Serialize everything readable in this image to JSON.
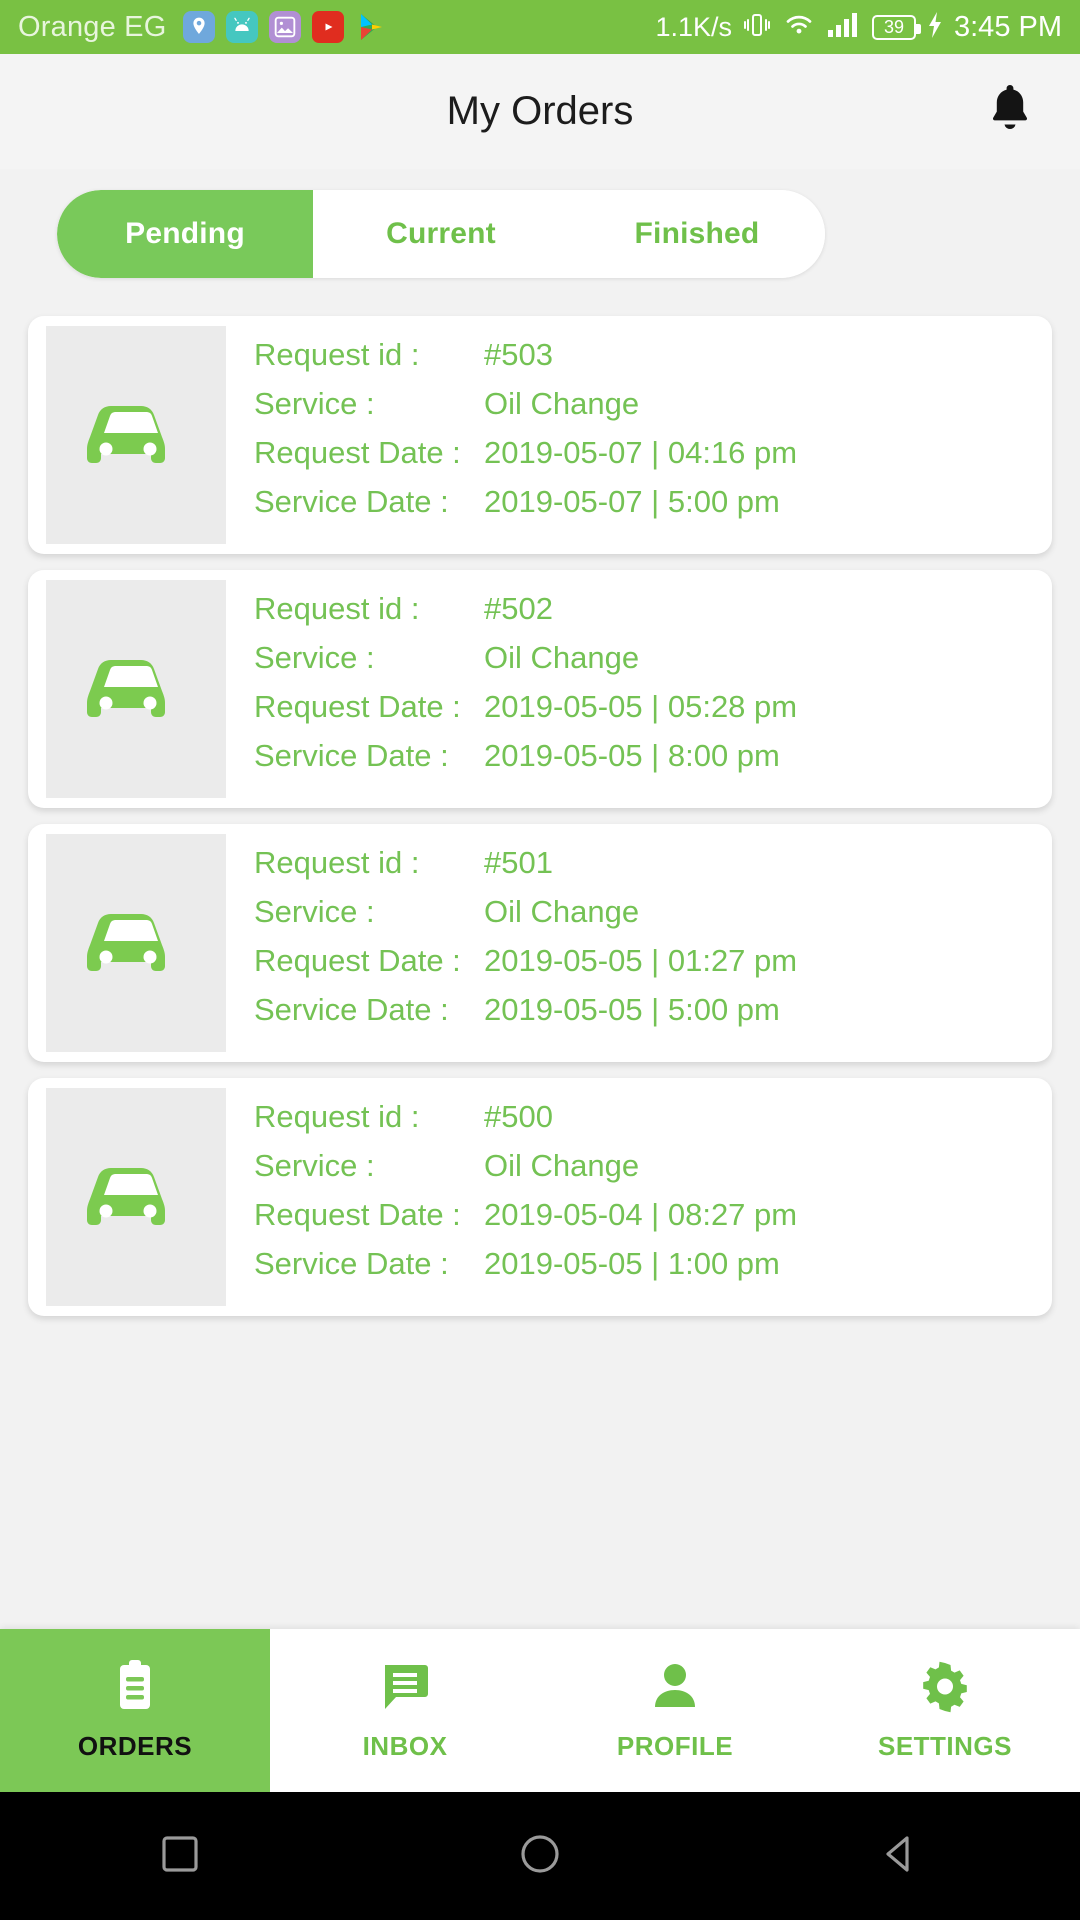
{
  "status_bar": {
    "carrier": "Orange EG",
    "network_speed": "1.1K/s",
    "battery_level": "39",
    "clock": "3:45 PM",
    "icons": [
      "maps-icon",
      "android-icon",
      "photos-icon",
      "youtube-icon",
      "play-store-icon",
      "vibrate-icon",
      "wifi-icon",
      "signal-icon",
      "battery-icon",
      "charging-bolt-icon"
    ],
    "background_color": "#79c143"
  },
  "header": {
    "title": "My Orders",
    "notification_icon": "bell-icon"
  },
  "tabs": {
    "active_index": 0,
    "items": [
      {
        "label": "Pending"
      },
      {
        "label": "Current"
      },
      {
        "label": "Finished"
      }
    ]
  },
  "labels": {
    "request_id": "Request id :",
    "service": "Service :",
    "request_date": "Request Date :",
    "service_date": "Service Date :"
  },
  "orders": [
    {
      "request_id": "#503",
      "service": "Oil Change",
      "request_date": "2019-05-07 | 04:16 pm",
      "service_date": "2019-05-07 | 5:00 pm",
      "thumb_icon": "car-icon"
    },
    {
      "request_id": "#502",
      "service": "Oil Change",
      "request_date": "2019-05-05 | 05:28 pm",
      "service_date": "2019-05-05 | 8:00 pm",
      "thumb_icon": "car-icon"
    },
    {
      "request_id": "#501",
      "service": "Oil Change",
      "request_date": "2019-05-05 | 01:27 pm",
      "service_date": "2019-05-05 | 5:00 pm",
      "thumb_icon": "car-icon"
    },
    {
      "request_id": "#500",
      "service": "Oil Change",
      "request_date": "2019-05-04 | 08:27 pm",
      "service_date": "2019-05-05 | 1:00 pm",
      "thumb_icon": "car-icon"
    }
  ],
  "bottom_nav": {
    "active_index": 0,
    "items": [
      {
        "label": "ORDERS",
        "icon": "clipboard-icon"
      },
      {
        "label": "INBOX",
        "icon": "chat-icon"
      },
      {
        "label": "PROFILE",
        "icon": "person-icon"
      },
      {
        "label": "SETTINGS",
        "icon": "gear-icon"
      }
    ]
  },
  "android_nav": {
    "items": [
      "recents-square-icon",
      "home-circle-icon",
      "back-triangle-icon"
    ]
  },
  "colors": {
    "brand_green": "#79c143",
    "text_green": "#74c254",
    "page_bg": "#f2f2f2"
  }
}
